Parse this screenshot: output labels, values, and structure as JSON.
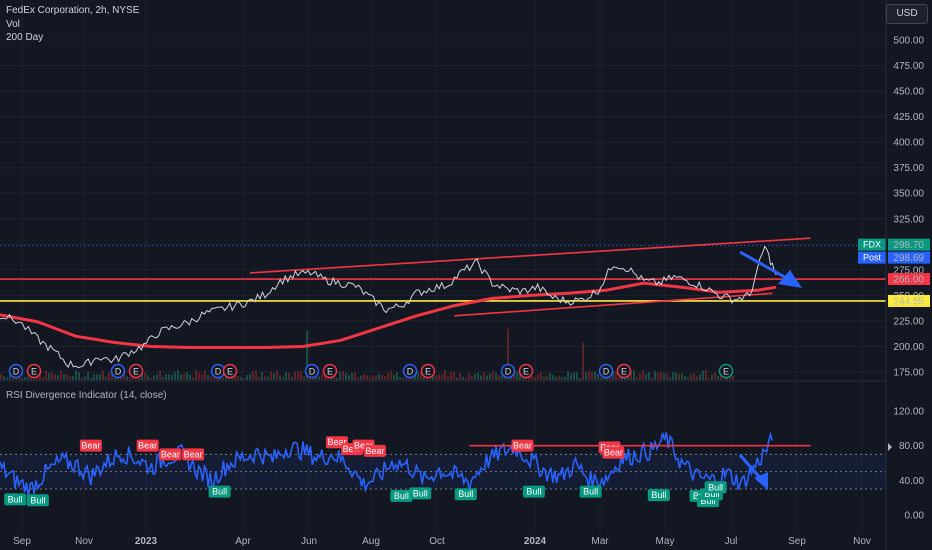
{
  "header": {
    "symbol_line": "FedEx Corporation, 2h, NYSE",
    "vol_label": "Vol",
    "ma_label": "200 Day",
    "currency_button": "USD"
  },
  "colors": {
    "background": "#131722",
    "price_line": "#d1d4dc",
    "trend_red": "#f23645",
    "support_yellow": "#ffeb3b",
    "rsi_blue": "#2962ff",
    "arrow_blue": "#2962ff",
    "bear_tag": "#f23645",
    "bull_tag": "#089981"
  },
  "chart_data": [
    {
      "type": "line",
      "title": "FedEx Corporation, 2h, NYSE",
      "x_ticks": [
        "Sep",
        "Nov",
        "2023",
        "Apr",
        "Jun",
        "Aug",
        "Oct",
        "2024",
        "Mar",
        "May",
        "Jul",
        "Sep",
        "Nov"
      ],
      "x_tick_bold": [
        false,
        false,
        true,
        false,
        false,
        false,
        false,
        true,
        false,
        false,
        false,
        false,
        false
      ],
      "y_ticks": [
        "500.00",
        "475.00",
        "450.00",
        "425.00",
        "400.00",
        "375.00",
        "350.00",
        "325.00",
        "300.00",
        "275.00",
        "250.00",
        "225.00",
        "200.00",
        "175.00"
      ],
      "ylim": [
        175,
        500
      ],
      "series": [
        {
          "x": [
            0,
            5,
            10,
            14,
            18,
            22,
            26,
            30,
            34,
            38,
            42,
            46,
            50,
            54,
            58,
            62,
            66,
            70,
            74,
            78,
            82,
            86,
            90,
            94,
            98,
            102,
            106,
            110,
            114,
            118,
            122,
            126,
            130,
            134,
            138,
            142,
            146,
            150,
            154,
            158,
            162,
            166,
            170,
            174,
            178,
            182,
            186,
            190,
            194,
            198,
            202,
            205
          ],
          "y": [
            231,
            224,
            207,
            196,
            183,
            181,
            190,
            186,
            194,
            201,
            214,
            219,
            224,
            232,
            236,
            240,
            244,
            251,
            264,
            270,
            272,
            265,
            262,
            259,
            247,
            236,
            240,
            252,
            257,
            260,
            273,
            282,
            262,
            256,
            254,
            258,
            248,
            244,
            246,
            255,
            281,
            276,
            264,
            262,
            268,
            264,
            258,
            250,
            246,
            250,
            298,
            270
          ]
        }
      ],
      "moving_average": {
        "name": "200 Day",
        "x": [
          0,
          10,
          20,
          30,
          40,
          50,
          60,
          70,
          80,
          90,
          100,
          110,
          120,
          130,
          140,
          150,
          160,
          170,
          180,
          190,
          200,
          205
        ],
        "y": [
          231,
          224,
          210,
          204,
          200,
          199,
          199,
          199,
          200,
          206,
          218,
          230,
          240,
          247,
          250,
          252,
          255,
          262,
          258,
          253,
          255,
          258
        ]
      },
      "trend_lines": [
        {
          "from": [
            66,
            272
          ],
          "to": [
            214,
            306
          ]
        },
        {
          "from": [
            120,
            230
          ],
          "to": [
            204,
            252
          ]
        }
      ],
      "horizontal_levels": [
        {
          "value": 266.0,
          "color": "#f23645"
        },
        {
          "value": 244.55,
          "color": "#ffeb3b"
        }
      ],
      "price_labels": [
        {
          "label": "FDX",
          "value": "298.70",
          "color": "#089981"
        },
        {
          "label": "Post",
          "value": "298.69",
          "color": "#2962ff"
        },
        {
          "label": "",
          "value": "266.00",
          "color": "#f23645"
        },
        {
          "label": "",
          "value": "244.55",
          "color": "#ffeb3b"
        }
      ],
      "earnings_markers": [
        "D",
        "E",
        "D",
        "E",
        "D",
        "E",
        "D",
        "E",
        "D",
        "E",
        "D",
        "E",
        "D",
        "E",
        "E"
      ]
    },
    {
      "type": "line",
      "title": "RSI Divergence Indicator (14, close)",
      "y_ticks": [
        "120.00",
        "80.00",
        "40.00",
        "0.00"
      ],
      "ylim": [
        -10,
        130
      ],
      "bands": [
        70,
        50,
        30
      ],
      "series": [
        {
          "x": [
            0,
            4,
            8,
            12,
            16,
            20,
            24,
            28,
            32,
            36,
            40,
            44,
            48,
            52,
            56,
            60,
            64,
            68,
            72,
            76,
            80,
            84,
            88,
            92,
            96,
            100,
            104,
            108,
            112,
            116,
            120,
            124,
            128,
            132,
            136,
            140,
            144,
            148,
            152,
            156,
            160,
            164,
            168,
            172,
            176,
            180,
            184,
            188,
            192,
            196,
            200,
            204
          ],
          "y": [
            55,
            40,
            30,
            48,
            62,
            58,
            45,
            60,
            72,
            65,
            55,
            66,
            70,
            52,
            40,
            58,
            66,
            72,
            64,
            78,
            74,
            66,
            70,
            58,
            36,
            44,
            62,
            56,
            40,
            52,
            46,
            38,
            60,
            72,
            78,
            64,
            50,
            44,
            58,
            40,
            42,
            64,
            70,
            74,
            88,
            60,
            44,
            40,
            48,
            36,
            60,
            86
          ]
        }
      ],
      "divergence_line": {
        "from": [
          124,
          80
        ],
        "to": [
          214,
          80
        ]
      },
      "signals": [
        {
          "label": "Bull",
          "x": 4,
          "y": 18
        },
        {
          "label": "Bull",
          "x": 10,
          "y": 17
        },
        {
          "label": "Bear",
          "x": 24,
          "y": 80
        },
        {
          "label": "Bear",
          "x": 39,
          "y": 80
        },
        {
          "label": "Bear",
          "x": 45,
          "y": 70
        },
        {
          "label": "Bear",
          "x": 51,
          "y": 70
        },
        {
          "label": "Bull",
          "x": 58,
          "y": 27
        },
        {
          "label": "Bear",
          "x": 89,
          "y": 84
        },
        {
          "label": "Bear",
          "x": 93,
          "y": 76
        },
        {
          "label": "Bear",
          "x": 96,
          "y": 80
        },
        {
          "label": "Bear",
          "x": 99,
          "y": 74
        },
        {
          "label": "Bull",
          "x": 106,
          "y": 22
        },
        {
          "label": "Bull",
          "x": 111,
          "y": 25
        },
        {
          "label": "Bull",
          "x": 123,
          "y": 24
        },
        {
          "label": "Bear",
          "x": 138,
          "y": 80
        },
        {
          "label": "Bull",
          "x": 141,
          "y": 27
        },
        {
          "label": "Bull",
          "x": 156,
          "y": 27
        },
        {
          "label": "Bear",
          "x": 161,
          "y": 78
        },
        {
          "label": "Bear",
          "x": 162,
          "y": 72
        },
        {
          "label": "Bull",
          "x": 174,
          "y": 23
        },
        {
          "label": "Bull",
          "x": 185,
          "y": 22
        },
        {
          "label": "Bull",
          "x": 187,
          "y": 16
        },
        {
          "label": "Bull",
          "x": 188,
          "y": 24
        },
        {
          "label": "Bull",
          "x": 189,
          "y": 32
        }
      ]
    }
  ]
}
